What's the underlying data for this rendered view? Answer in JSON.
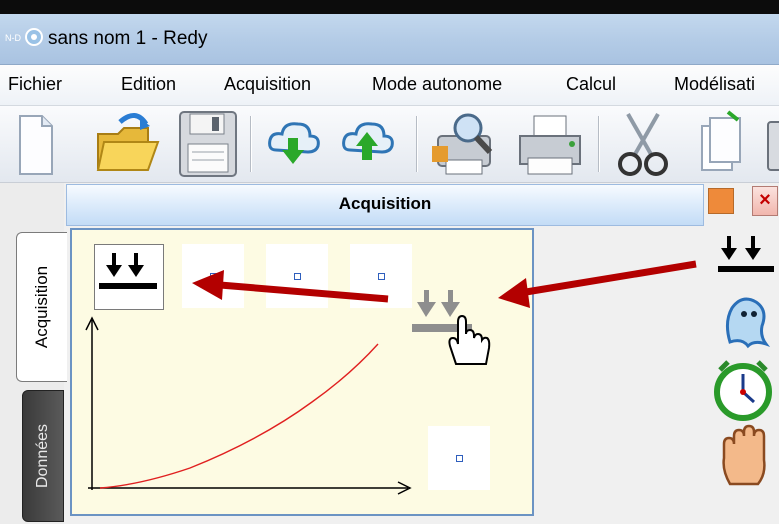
{
  "window": {
    "title": "sans nom 1 - Redy"
  },
  "menu": {
    "items": [
      "Fichier",
      "Edition",
      "Acquisition",
      "Mode autonome",
      "Calcul",
      "Modélisati"
    ]
  },
  "toolbar": {
    "buttons": [
      "new-document",
      "open-folder",
      "save-floppy",
      "cloud-download",
      "cloud-upload",
      "print-preview",
      "print",
      "cut",
      "copy",
      "paste"
    ]
  },
  "left_tabs": {
    "acquisition": "Acquisition",
    "donnees": "Données"
  },
  "panel": {
    "title": "Acquisition"
  },
  "canvas": {
    "mode_icon": "trigger-down-arrows-icon",
    "curve_color": "#e02020"
  },
  "right_palette": {
    "icons": [
      "trigger-down-arrows-icon",
      "ghost-icon",
      "stopwatch-icon",
      "hand-stop-icon"
    ]
  },
  "annotations": {
    "arrow_color": "#b30000",
    "drag_icon": "trigger-down-arrows-cursor-icon"
  },
  "colors": {
    "titlebar": "#b3cbe6",
    "panel_header": "#dcebfb",
    "canvas_bg": "#fdfbe3",
    "tab_inactive": "#4a4a4a"
  }
}
